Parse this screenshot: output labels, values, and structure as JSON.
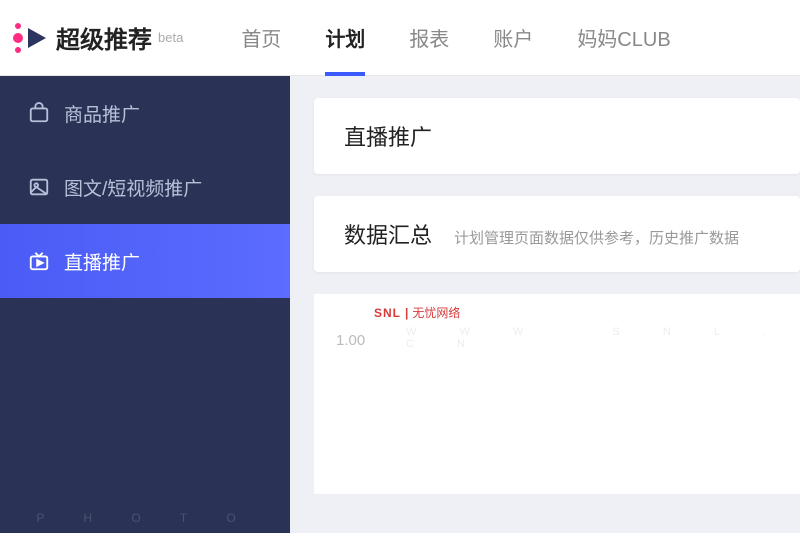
{
  "header": {
    "brand": "超级推荐",
    "beta": "beta",
    "nav": [
      {
        "label": "首页",
        "active": false
      },
      {
        "label": "计划",
        "active": true
      },
      {
        "label": "报表",
        "active": false
      },
      {
        "label": "账户",
        "active": false
      },
      {
        "label": "妈妈CLUB",
        "active": false
      }
    ]
  },
  "sidebar": {
    "items": [
      {
        "label": "商品推广",
        "icon": "bag-icon",
        "active": false
      },
      {
        "label": "图文/短视频推广",
        "icon": "image-icon",
        "active": false
      },
      {
        "label": "直播推广",
        "icon": "live-icon",
        "active": true
      }
    ],
    "watermark": "P H O T O"
  },
  "main": {
    "card1": {
      "title": "直播推广"
    },
    "card2": {
      "title": "数据汇总",
      "hint": "计划管理页面数据仅供参考，历史推广数据"
    },
    "snl": {
      "en": "SNL",
      "cn": "无忧网络"
    },
    "ylabel": "1.00",
    "wm": "W W W . S N L . C N"
  }
}
